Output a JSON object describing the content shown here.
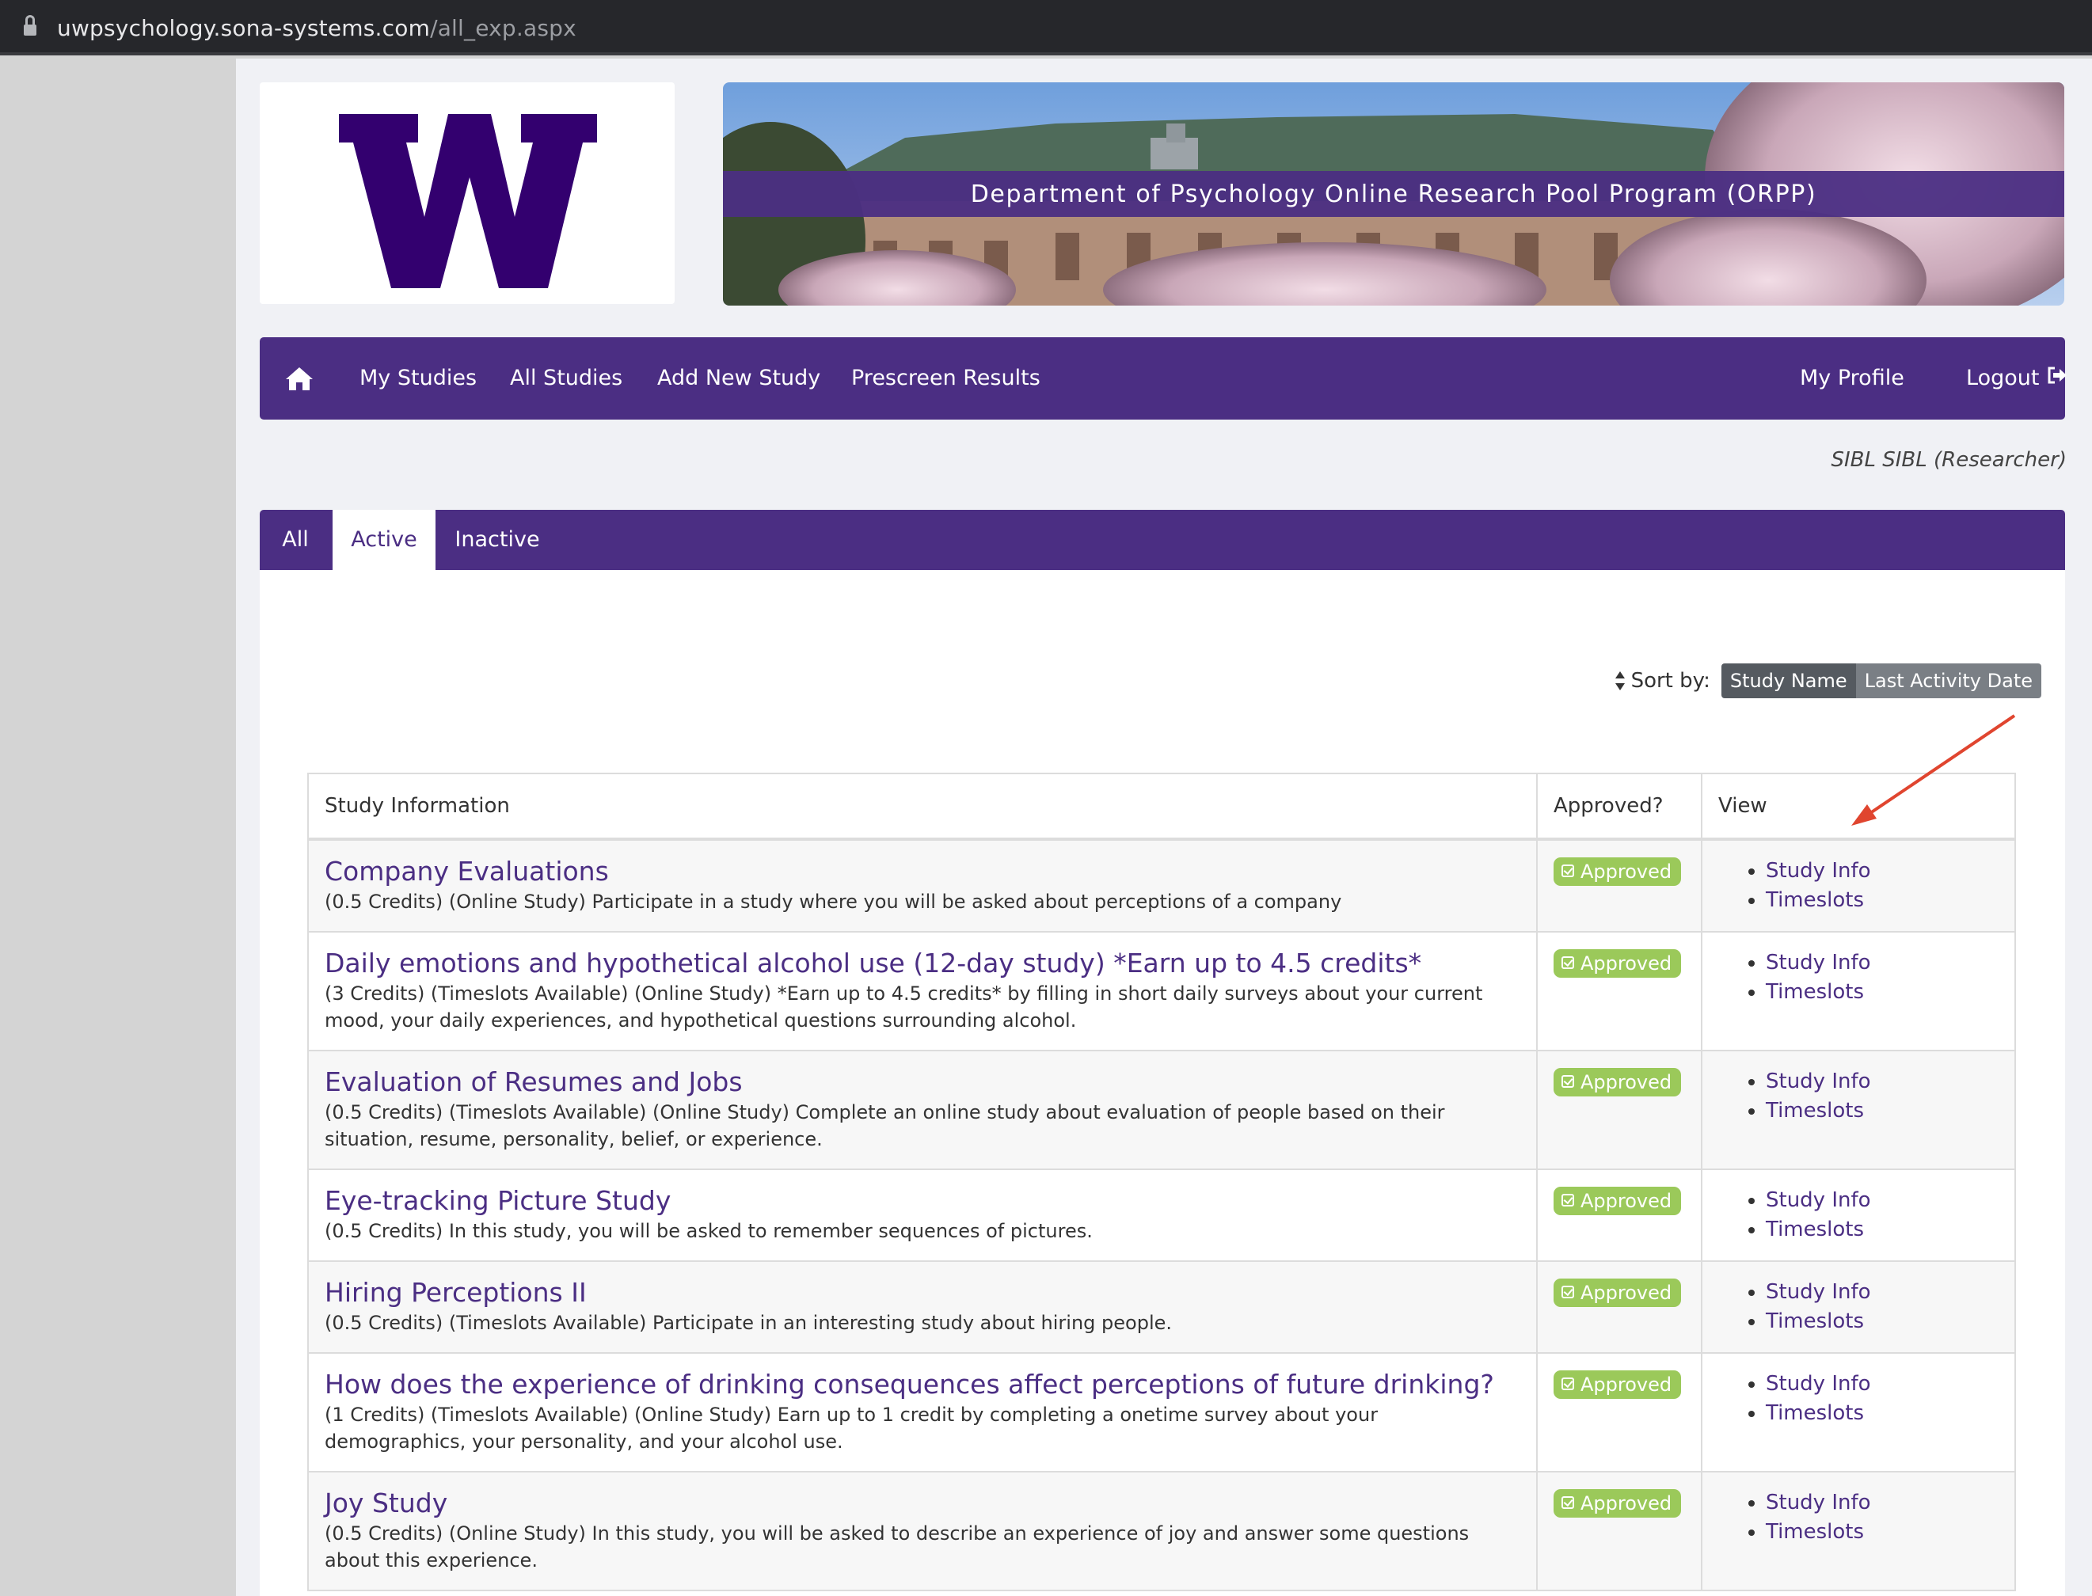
{
  "browser": {
    "url_host": "uwpsychology.sona-systems.com",
    "url_path": "/all_exp.aspx"
  },
  "header": {
    "banner_title": "Department of Psychology Online Research Pool Program (ORPP)",
    "logo_letter": "W"
  },
  "nav": {
    "items": [
      "My Studies",
      "All Studies",
      "Add New Study",
      "Prescreen Results"
    ],
    "my_profile": "My Profile",
    "logout": "Logout"
  },
  "user": {
    "label": "SIBL SIBL (Researcher)"
  },
  "tabs": [
    "All",
    "Active",
    "Inactive"
  ],
  "active_tab": "Active",
  "sort": {
    "label": "Sort by:",
    "options": [
      "Study Name",
      "Last Activity Date"
    ],
    "selected": "Study Name"
  },
  "table": {
    "headers": [
      "Study Information",
      "Approved?",
      "View"
    ],
    "approved_label": "Approved",
    "view_links": [
      "Study Info",
      "Timeslots"
    ],
    "rows": [
      {
        "title": "Company Evaluations",
        "description": "(0.5 Credits) (Online Study) Participate in a study where you will be asked about perceptions of a company"
      },
      {
        "title": "Daily emotions and hypothetical alcohol use (12-day study) *Earn up to 4.5 credits*",
        "description": "(3 Credits) (Timeslots Available) (Online Study) *Earn up to 4.5 credits* by filling in short daily surveys about your current mood, your daily experiences, and hypothetical questions surrounding alcohol."
      },
      {
        "title": "Evaluation of Resumes and Jobs",
        "description": "(0.5 Credits) (Timeslots Available) (Online Study) Complete an online study about evaluation of people based on their situation, resume, personality, belief, or experience."
      },
      {
        "title": "Eye-tracking Picture Study",
        "description": "(0.5 Credits) In this study, you will be asked to remember sequences of pictures."
      },
      {
        "title": "Hiring Perceptions II",
        "description": "(0.5 Credits) (Timeslots Available) Participate in an interesting study about hiring people."
      },
      {
        "title": "How does the experience of drinking consequences affect perceptions of future drinking?",
        "description": "(1 Credits) (Timeslots Available) (Online Study) Earn up to 1 credit by completing a onetime survey about your demographics, your personality, and your alcohol use."
      },
      {
        "title": "Joy Study",
        "description": "(0.5 Credits) (Online Study) In this study, you will be asked to describe an experience of joy and answer some questions about this experience."
      }
    ]
  },
  "colors": {
    "brand_purple": "#4b2e83",
    "approved_green": "#9bc95a",
    "annotation_red": "#e0452f"
  },
  "icons": [
    "lock-icon",
    "home-icon",
    "logout-icon",
    "sort-icon",
    "check-square-icon",
    "annotation-arrow"
  ]
}
